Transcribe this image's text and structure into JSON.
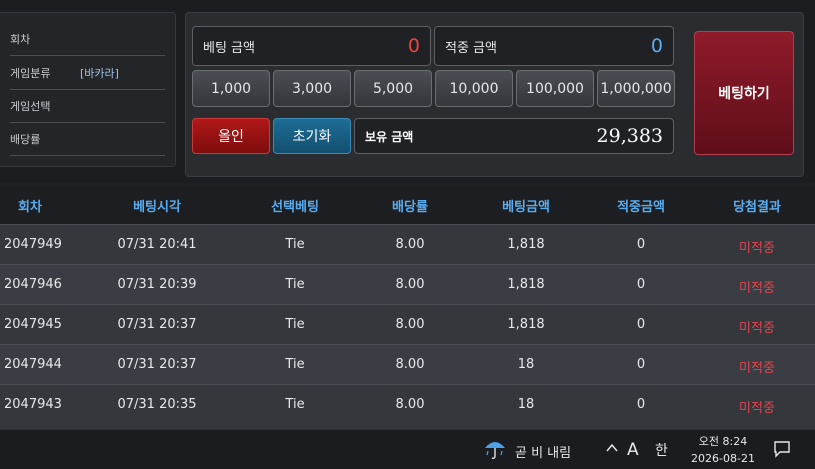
{
  "info": {
    "round_label": "회차",
    "category_label": "게임분류",
    "category_value": "[바카라]",
    "selection_label": "게임선택",
    "odds_label": "배당률"
  },
  "bet": {
    "bet_amount_label": "베팅 금액",
    "bet_amount_value": "0",
    "win_amount_label": "적중 금액",
    "win_amount_value": "0",
    "chips": [
      "1,000",
      "3,000",
      "5,000",
      "10,000",
      "100,000",
      "1,000,000"
    ],
    "allin_label": "올인",
    "reset_label": "초기화",
    "balance_label": "보유 금액",
    "balance_value": "29,383",
    "submit_label": "베팅하기"
  },
  "table": {
    "headers": [
      "회차",
      "베팅시각",
      "선택베팅",
      "배당률",
      "베팅금액",
      "적중금액",
      "당첨결과"
    ],
    "rows": [
      [
        "2047949",
        "07/31 20:41",
        "Tie",
        "8.00",
        "1,818",
        "0",
        "미적중"
      ],
      [
        "2047946",
        "07/31 20:39",
        "Tie",
        "8.00",
        "1,818",
        "0",
        "미적중"
      ],
      [
        "2047945",
        "07/31 20:37",
        "Tie",
        "8.00",
        "1,818",
        "0",
        "미적중"
      ],
      [
        "2047944",
        "07/31 20:37",
        "Tie",
        "8.00",
        "18",
        "0",
        "미적중"
      ],
      [
        "2047943",
        "07/31 20:35",
        "Tie",
        "8.00",
        "18",
        "0",
        "미적중"
      ]
    ]
  },
  "taskbar": {
    "weather_text": "곧 비 내림",
    "font_indicator": "A",
    "ime_indicator": "한",
    "time": "오전 8:24",
    "date": "2026-08-21",
    "icons": [
      "rain-umbrella-icon",
      "chevron-up-icon",
      "notification-icon"
    ]
  },
  "colors": {
    "bet_amount": "#e8453c",
    "win_amount": "#5aaef0",
    "header_text": "#5aaef0",
    "result_miss": "#e2464c"
  }
}
